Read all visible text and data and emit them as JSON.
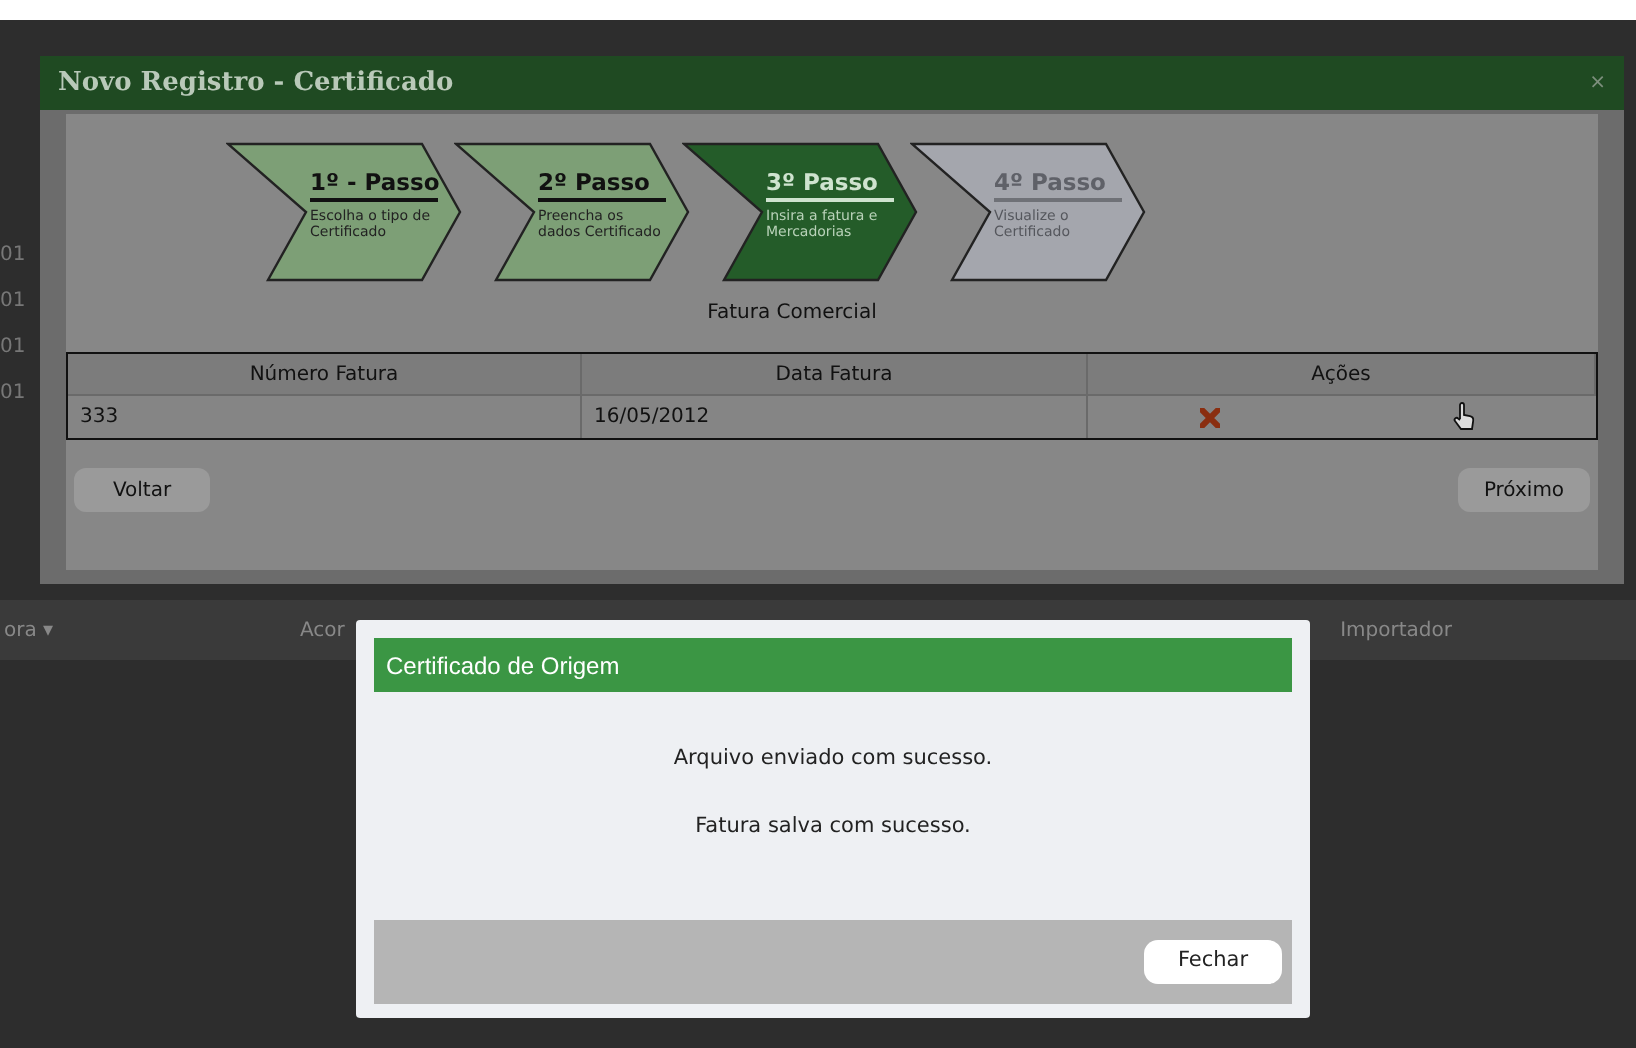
{
  "background": {
    "row_labels": [
      "01",
      "01",
      "01",
      "01"
    ],
    "columns": [
      "ora ▾",
      "Acor",
      "Importador"
    ]
  },
  "dialog": {
    "title": "Novo Registro - Certificado",
    "close": "×",
    "steps": [
      {
        "title": "1º - Passo",
        "caption": "Escolha o tipo de Certificado",
        "selected": false,
        "disabled": false
      },
      {
        "title": "2º Passo",
        "caption": "Preencha os dados Certificado",
        "selected": false,
        "disabled": false
      },
      {
        "title": "3º Passo",
        "caption": "Insira a fatura e Mercadorias",
        "selected": true,
        "disabled": false
      },
      {
        "title": "4º Passo",
        "caption": "Visualize o Certificado",
        "selected": false,
        "disabled": true
      }
    ],
    "section_title": "Fatura Comercial",
    "table": {
      "columns": [
        "Número Fatura",
        "Data Fatura",
        "Ações"
      ],
      "rows": [
        {
          "number": "333",
          "date": "16/05/2012"
        }
      ]
    },
    "back_button": "Voltar",
    "next_button": "Próximo"
  },
  "message_box": {
    "title": "Certificado de Origem",
    "messages": [
      "Arquivo enviado com sucesso.",
      "Fatura salva com sucesso."
    ],
    "close_button": "Fechar"
  }
}
